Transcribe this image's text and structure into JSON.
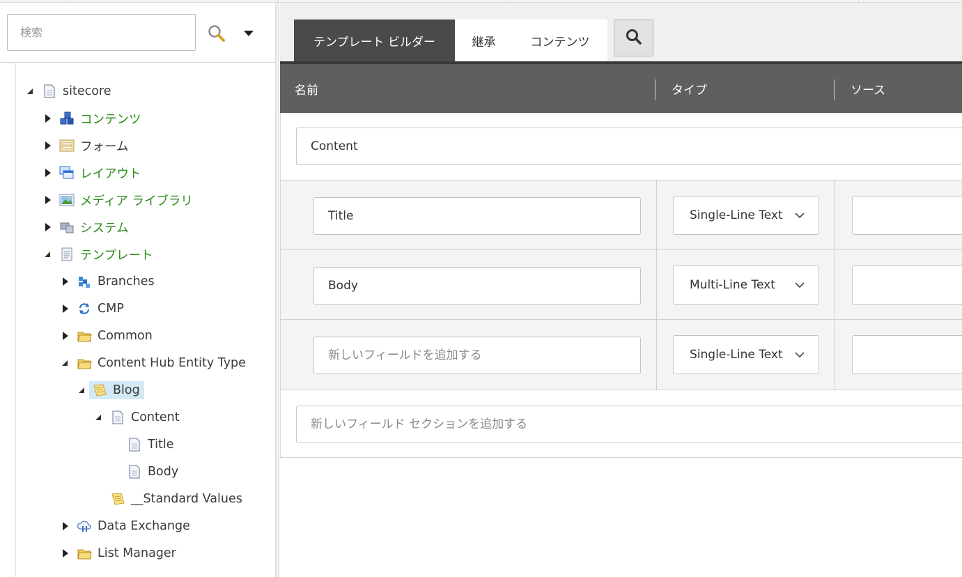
{
  "sidebar": {
    "search_placeholder": "検索",
    "tree": [
      {
        "label": "sitecore",
        "color": "gray",
        "expanded": true
      },
      {
        "label": "コンテンツ",
        "color": "green"
      },
      {
        "label": "フォーム",
        "color": "gray"
      },
      {
        "label": "レイアウト",
        "color": "green"
      },
      {
        "label": "メディア ライブラリ",
        "color": "green"
      },
      {
        "label": "システム",
        "color": "green"
      },
      {
        "label": "テンプレート",
        "color": "green",
        "expanded": true
      },
      {
        "label": "Branches",
        "color": "gray"
      },
      {
        "label": "CMP",
        "color": "gray"
      },
      {
        "label": "Common",
        "color": "gray"
      },
      {
        "label": "Content Hub Entity Type",
        "color": "gray",
        "expanded": true
      },
      {
        "label": "Blog",
        "color": "gray",
        "expanded": true,
        "selected": true
      },
      {
        "label": "Content",
        "color": "gray",
        "expanded": true
      },
      {
        "label": "Title",
        "color": "gray"
      },
      {
        "label": "Body",
        "color": "gray"
      },
      {
        "label": "__Standard Values",
        "color": "gray"
      },
      {
        "label": "Data Exchange",
        "color": "gray"
      },
      {
        "label": "List Manager",
        "color": "gray"
      }
    ]
  },
  "tabs": [
    {
      "label": "テンプレート ビルダー",
      "active": true
    },
    {
      "label": "継承",
      "active": false
    },
    {
      "label": "コンテンツ",
      "active": false
    }
  ],
  "columns": {
    "name": "名前",
    "type": "タイプ",
    "source": "ソース"
  },
  "builder": {
    "section_name": "Content",
    "fields": [
      {
        "name": "Title",
        "name_placeholder": "",
        "type": "Single-Line Text",
        "source": ""
      },
      {
        "name": "Body",
        "name_placeholder": "",
        "type": "Multi-Line Text",
        "source": ""
      },
      {
        "name": "",
        "name_placeholder": "新しいフィールドを追加する",
        "type": "Single-Line Text",
        "source": ""
      }
    ],
    "new_section_placeholder": "新しいフィールド セクションを追加する"
  },
  "colors": {
    "green_label": "#2b8a18",
    "active_tab": "#4a4a4a",
    "header_bg": "#5f5f5f",
    "selected_bg": "#d3e9f5"
  }
}
